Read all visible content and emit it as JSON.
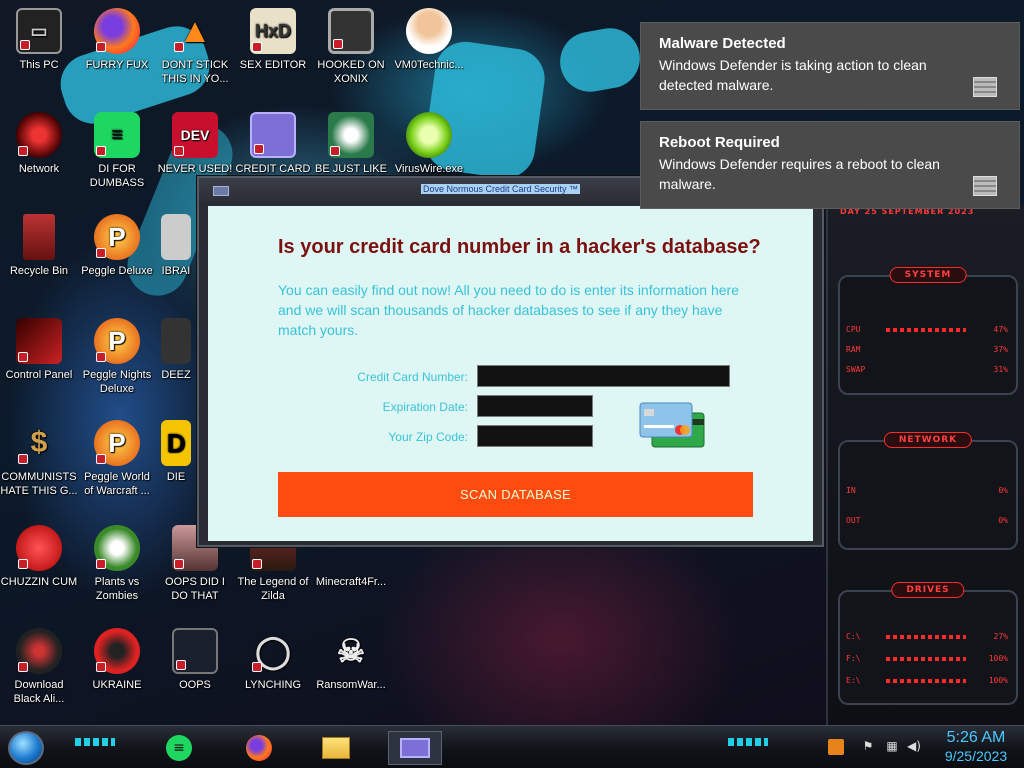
{
  "desktop": {
    "icons": [
      {
        "label": "This PC",
        "icon": "computer-icon"
      },
      {
        "label": "FURRY FUX",
        "icon": "firefox-icon"
      },
      {
        "label": "DONT STICK THIS IN YO...",
        "icon": "vlc-cone-icon"
      },
      {
        "label": "SEX EDITOR",
        "icon": "hxd-editor-icon"
      },
      {
        "label": "HOOKED ON XONIX",
        "icon": "xonix-game-icon"
      },
      {
        "label": "VM0Technic...",
        "icon": "doctor-avatar-icon"
      },
      {
        "label": "Network",
        "icon": "network-orb-icon"
      },
      {
        "label": "DI FOR DUMBASS",
        "icon": "spotify-like-icon"
      },
      {
        "label": "NEVER USED!",
        "icon": "devcpp-icon"
      },
      {
        "label": "CREDIT CARD",
        "icon": "credit-card-icon"
      },
      {
        "label": "BE JUST LIKE",
        "icon": "bonzi-santa-icon"
      },
      {
        "label": "VirusWire.exe",
        "icon": "lime-icon"
      },
      {
        "label": "Recycle Bin",
        "icon": "recycle-bin-icon"
      },
      {
        "label": "Peggle Deluxe",
        "icon": "peggle-icon"
      },
      {
        "label": "IBRAI",
        "icon": "robot-icon"
      },
      {
        "label": "Control Panel",
        "icon": "control-panel-icon"
      },
      {
        "label": "Peggle Nights Deluxe",
        "icon": "peggle-nights-icon"
      },
      {
        "label": "DEEZ",
        "icon": "deez-icon"
      },
      {
        "label": "COMMUNISTS HATE THIS G...",
        "icon": "money-bag-icon"
      },
      {
        "label": "Peggle World of Warcraft ...",
        "icon": "peggle-wow-icon"
      },
      {
        "label": "DIE",
        "icon": "die-icon"
      },
      {
        "label": "CHUZZIN CUM",
        "icon": "chuzzle-icon"
      },
      {
        "label": "Plants vs Zombies",
        "icon": "pvz-icon"
      },
      {
        "label": "OOPS DID I DO THAT",
        "icon": "portrait-icon"
      },
      {
        "label": "The Legend of Zilda",
        "icon": "zelda-icon"
      },
      {
        "label": "Minecraft4Fr...",
        "icon": "minecraft-icon"
      },
      {
        "label": "Download Black Ali...",
        "icon": "black-orb-icon"
      },
      {
        "label": "UKRAINE",
        "icon": "radiation-icon"
      },
      {
        "label": "OOPS",
        "icon": "oops-window-icon"
      },
      {
        "label": "LYNCHING",
        "icon": "noose-icon"
      },
      {
        "label": "RansomWar...",
        "icon": "skull-icon"
      }
    ]
  },
  "notifications": [
    {
      "title": "Malware Detected",
      "body": "Windows Defender is taking action to clean detected malware."
    },
    {
      "title": "Reboot Required",
      "body": "Windows Defender requires a reboot to clean malware."
    }
  ],
  "app": {
    "window_title": "Dove Normous Credit Card Security ™",
    "heading": "Is your credit card number in a hacker's database?",
    "description": "You can easily find out now! All you need to do is enter its information here and we will scan thousands of hacker databases to see if any they have match yours.",
    "fields": {
      "card_number_label": "Credit Card Number:",
      "card_number_value": "",
      "expiration_label": "Expiration Date:",
      "expiration_value": "",
      "zip_label": "Your Zip Code:",
      "zip_value": ""
    },
    "scan_button": "SCAN DATABASE"
  },
  "widget": {
    "date_text": "DAY 25 SEPTEMBER 2023",
    "system_title": "SYSTEM",
    "system_rows": [
      {
        "label": "CPU",
        "value": "47%"
      },
      {
        "label": "RAM",
        "value": "37%"
      },
      {
        "label": "SWAP",
        "value": "31%"
      }
    ],
    "network_title": "NETWORK",
    "network_rows": [
      {
        "label": "IN",
        "value": "0%"
      },
      {
        "label": "OUT",
        "value": "0%"
      }
    ],
    "drives_title": "DRIVES",
    "drives_rows": [
      {
        "label": "C:\\",
        "value": "27%"
      },
      {
        "label": "F:\\",
        "value": "100%"
      },
      {
        "label": "E:\\",
        "value": "100%"
      }
    ]
  },
  "taskbar": {
    "apps": [
      "spotify-icon",
      "firefox-icon",
      "file-explorer-icon",
      "credit-card-app-icon"
    ],
    "tray": [
      "sound-app-icon",
      "flag-icon",
      "network-tray-icon",
      "volume-icon"
    ],
    "time": "5:26 AM",
    "date": "9/25/2023"
  },
  "colors": {
    "app_background": "#dff7f4",
    "heading": "#7a1010",
    "description": "#39c2d8",
    "scan_button": "#ff4a10",
    "clock": "#4ac8ff"
  }
}
